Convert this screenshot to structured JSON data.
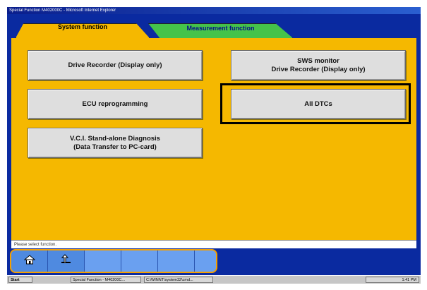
{
  "window": {
    "title": "Special Function M402000C - Microsoft Internet Explorer"
  },
  "tabs": {
    "system": "System function",
    "measurement": "Measurement function"
  },
  "buttons": {
    "drive_recorder": "Drive Recorder (Display only)",
    "sws_line1": "SWS monitor",
    "sws_line2": "Drive Recorder (Display only)",
    "ecu_reprogramming": "ECU reprogramming",
    "all_dtcs": "All DTCs",
    "vci_line1": "V.C.I. Stand-alone Diagnosis",
    "vci_line2": "(Data Transfer to PC-card)"
  },
  "status": {
    "message": "Please select function."
  },
  "taskbar": {
    "start": "Start",
    "task1": "Special Function - M40200C...",
    "task2": "C:\\WINNT\\system32\\cmd...",
    "clock": "1:41 PM"
  },
  "icons": {
    "home": "home-icon",
    "back": "back-arrow-icon"
  },
  "colors": {
    "panel": "#f5b800",
    "active_tab": "#f5b800",
    "inactive_tab": "#45c34a",
    "highlight_border": "#000000"
  }
}
